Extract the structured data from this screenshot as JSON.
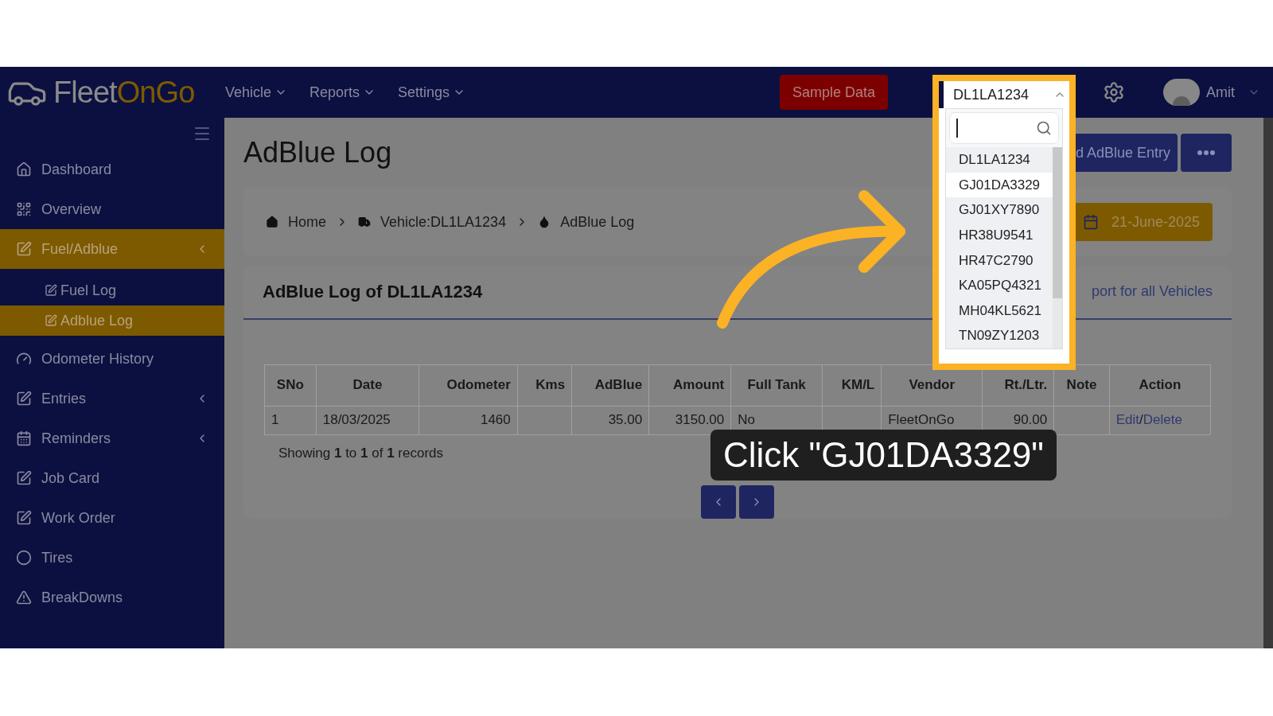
{
  "header": {
    "logo": {
      "part_1": "Fleet",
      "part_2": "On",
      "part_3": "Go"
    },
    "nav": [
      "Vehicle",
      "Reports",
      "Settings"
    ],
    "sample_button": "Sample Data",
    "user": "Amit"
  },
  "sidebar": {
    "items": [
      {
        "label": "Dashboard",
        "active": false,
        "has_submenu": false
      },
      {
        "label": "Overview",
        "active": false,
        "has_submenu": false
      },
      {
        "label": "Fuel/Adblue",
        "active": true,
        "has_submenu": true,
        "children": [
          {
            "label": "Fuel Log",
            "active": false
          },
          {
            "label": "Adblue Log",
            "active": true
          }
        ]
      },
      {
        "label": "Odometer History",
        "active": false,
        "has_submenu": false
      },
      {
        "label": "Entries",
        "active": false,
        "has_submenu": true
      },
      {
        "label": "Reminders",
        "active": false,
        "has_submenu": true
      },
      {
        "label": "Job Card",
        "active": false,
        "has_submenu": false
      },
      {
        "label": "Work Order",
        "active": false,
        "has_submenu": false
      },
      {
        "label": "Tires",
        "active": false,
        "has_submenu": false
      },
      {
        "label": "BreakDowns",
        "active": false,
        "has_submenu": false
      }
    ]
  },
  "page": {
    "title": "AdBlue Log",
    "add_button": "d AdBlue Entry",
    "date_button": "21-June-2025",
    "breadcrumb": [
      "Home",
      "Vehicle:DL1LA1234",
      "AdBlue Log"
    ]
  },
  "card": {
    "title": "AdBlue Log of DL1LA1234",
    "export_link": "port for all Vehicles",
    "table": {
      "columns": [
        "SNo",
        "Date",
        "Odometer",
        "Kms",
        "AdBlue",
        "Amount",
        "Full Tank",
        "KM/L",
        "Vendor",
        "Rt./Ltr.",
        "Note",
        "Action"
      ],
      "rows": [
        {
          "cells": [
            "1",
            "18/03/2025",
            "1460",
            null,
            "35.00",
            "3150.00",
            "No",
            null,
            "FleetOnGo",
            "90.00",
            null
          ],
          "actions": [
            "Edit",
            "Delete"
          ],
          "separator": "/"
        }
      ]
    },
    "footer": "Showing **1** to **1** of **1** records"
  },
  "vehicle_select": {
    "value": "DL1LA1234",
    "options": [
      {
        "label": "DL1LA1234",
        "highlighted": false
      },
      {
        "label": "GJ01DA3329",
        "highlighted": true
      },
      {
        "label": "GJ01XY7890",
        "highlighted": false
      },
      {
        "label": "HR38U9541",
        "highlighted": false
      },
      {
        "label": "HR47C2790",
        "highlighted": false
      },
      {
        "label": "KA05PQ4321",
        "highlighted": false
      },
      {
        "label": "MH04KL5621",
        "highlighted": false
      },
      {
        "label": "TN09ZY1203",
        "highlighted": false
      }
    ]
  },
  "tooltip": "Click \"GJ01DA3329\""
}
